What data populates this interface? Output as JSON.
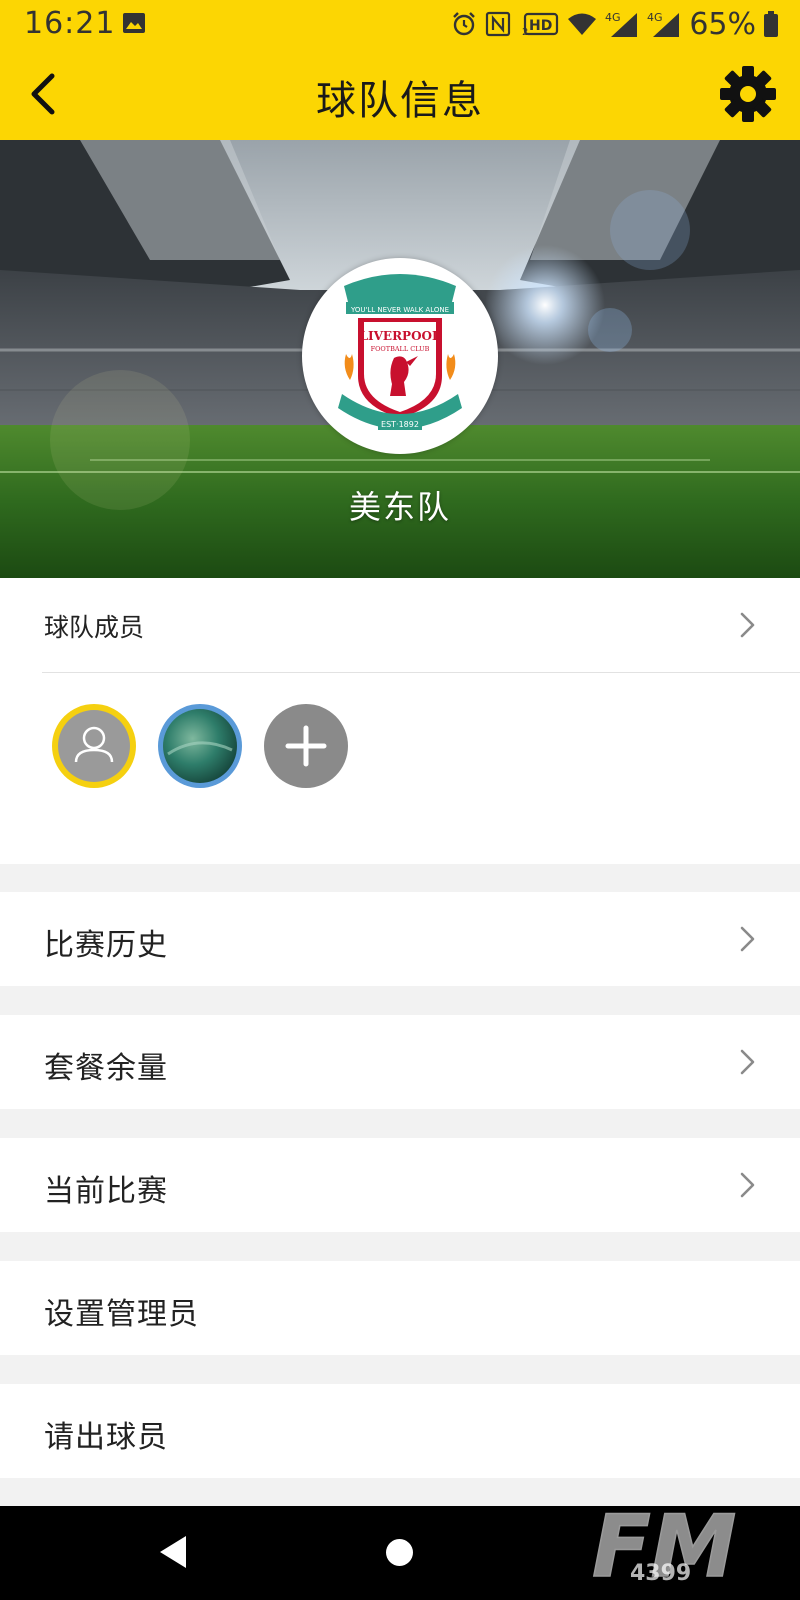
{
  "status_bar": {
    "time": "16:21",
    "battery": "65%",
    "network_1": "4G",
    "network_2": "4G",
    "hd_label": "HD",
    "icons": [
      "image-icon",
      "alarm-icon",
      "nfc-icon",
      "hd-icon",
      "wifi-icon",
      "signal-icon",
      "signal-icon",
      "battery-icon"
    ]
  },
  "toolbar": {
    "title": "球队信息",
    "back_icon": "chevron-left-icon",
    "settings_icon": "gear-icon",
    "color": "#fcd603"
  },
  "team": {
    "name": "美东队",
    "logo_texts": [
      "YOU'LL NEVER WALK ALONE",
      "LIVERPOOL",
      "FOOTBALL CLUB",
      "EST 1892"
    ]
  },
  "members": {
    "title": "球队成员",
    "avatars": [
      {
        "type": "default-user",
        "border": "#f5d010"
      },
      {
        "type": "photo",
        "border": "#5a9ad8"
      },
      {
        "type": "add-button"
      }
    ]
  },
  "menu": {
    "match_history": "比赛历史",
    "package_balance": "套餐余量",
    "current_match": "当前比赛",
    "set_admin": "设置管理员",
    "remove_player": "请出球员"
  },
  "watermark": {
    "big": "FM",
    "small": "4399"
  }
}
